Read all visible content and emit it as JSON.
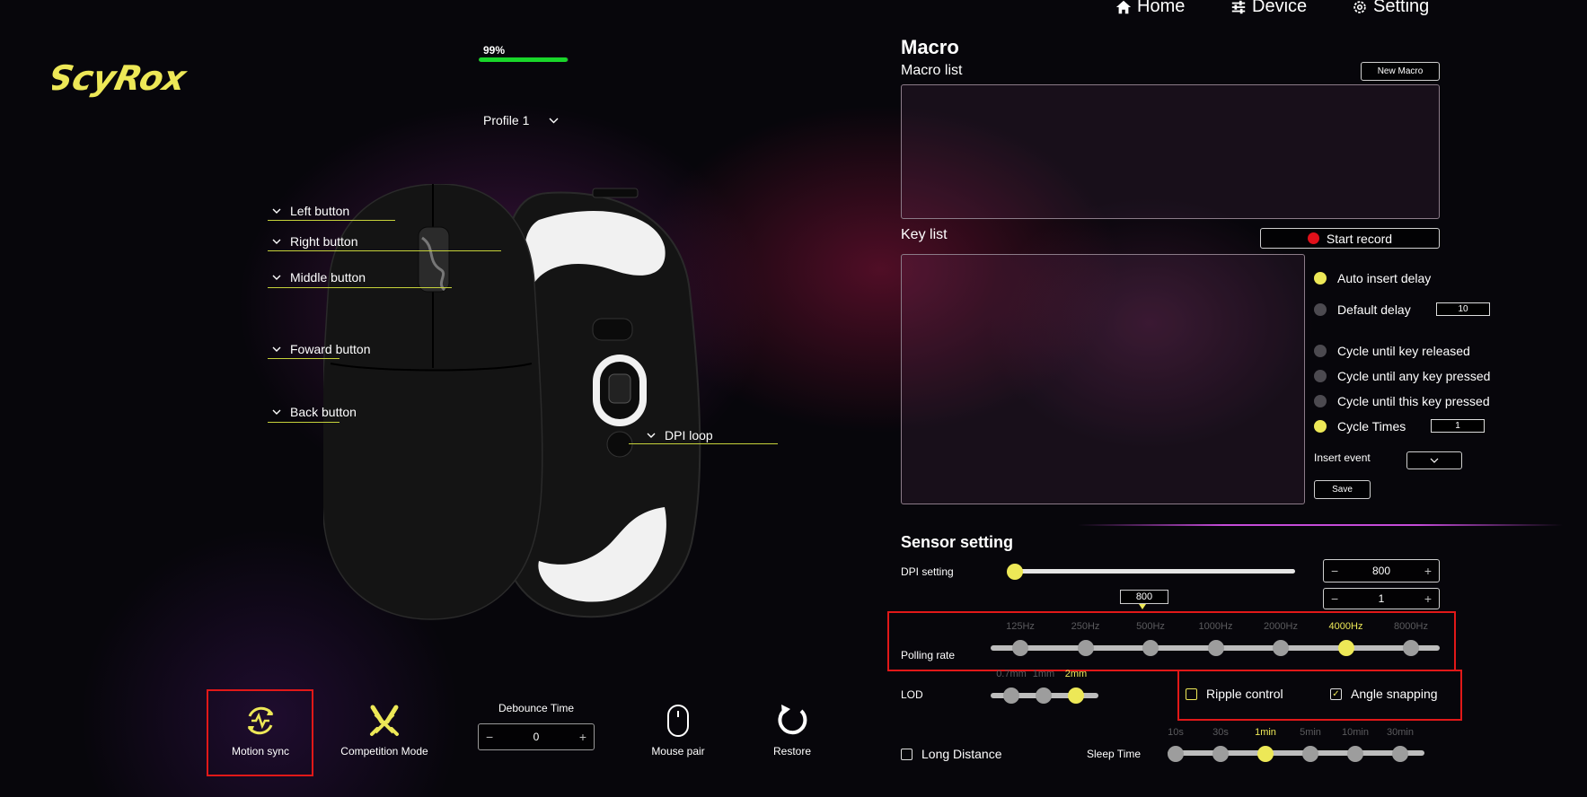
{
  "nav": {
    "home": "Home",
    "device": "Device",
    "setting": "Setting"
  },
  "brand": {
    "logo_text": "ScyRox",
    "logo_color": "#ede857"
  },
  "battery": {
    "text": "99%",
    "level_percent": 99,
    "color": "#19d62a"
  },
  "profile": {
    "label": "Profile 1"
  },
  "buttons": {
    "left": "Left button",
    "right": "Right button",
    "middle": "Middle button",
    "forward": "Foward button",
    "back": "Back button",
    "dpi_loop": "DPI loop"
  },
  "macro": {
    "title": "Macro",
    "macro_list_label": "Macro list",
    "new_macro": "New Macro",
    "key_list_label": "Key list",
    "start_record": "Start record",
    "options": {
      "auto_insert_delay": "Auto insert delay",
      "default_delay": "Default delay",
      "default_delay_value": "10",
      "cycle_released": "Cycle until key released",
      "cycle_any": "Cycle until any key pressed",
      "cycle_this": "Cycle until this key pressed",
      "cycle_times": "Cycle Times",
      "cycle_times_value": "1"
    },
    "insert_event": "Insert event",
    "save": "Save"
  },
  "sensor": {
    "title": "Sensor setting",
    "dpi_label": "DPI setting",
    "dpi_value": "800",
    "dpi_stage": "1",
    "dpi_bubble": "800",
    "polling_label": "Polling rate",
    "polling_options": [
      "125Hz",
      "250Hz",
      "500Hz",
      "1000Hz",
      "2000Hz",
      "4000Hz",
      "8000Hz"
    ],
    "polling_selected": "4000Hz",
    "lod_label": "LOD",
    "lod_options": [
      "0.7mm",
      "1mm",
      "2mm"
    ],
    "lod_selected": "2mm",
    "ripple_control": "Ripple control",
    "angle_snapping": "Angle snapping",
    "long_distance": "Long Distance",
    "sleep_label": "Sleep Time",
    "sleep_options": [
      "10s",
      "30s",
      "1min",
      "5min",
      "10min",
      "30min"
    ],
    "sleep_selected": "1min"
  },
  "bottom": {
    "motion_sync": "Motion sync",
    "competition_mode": "Competition Mode",
    "debounce_label": "Debounce Time",
    "debounce_value": "0",
    "mouse_pair": "Mouse pair",
    "restore": "Restore"
  }
}
